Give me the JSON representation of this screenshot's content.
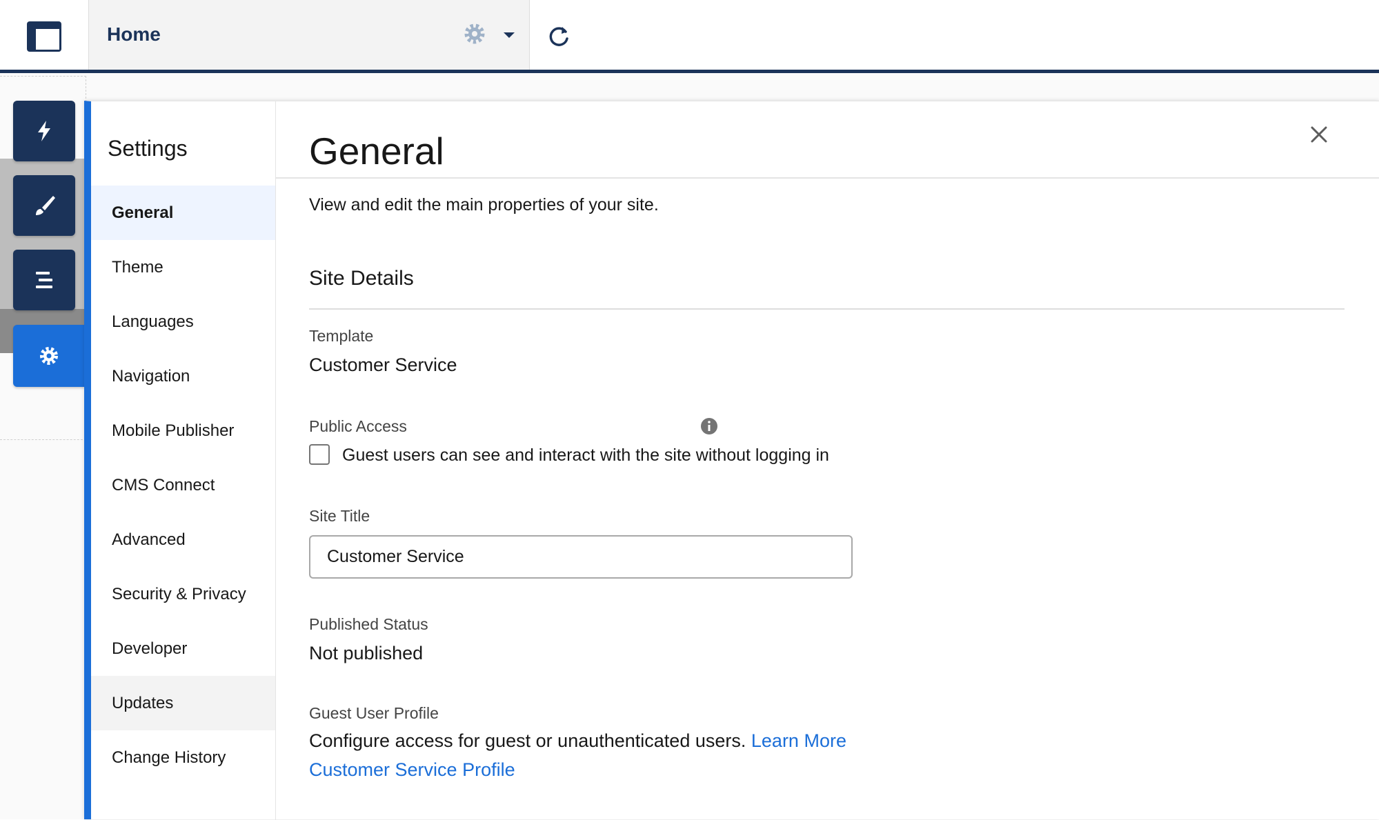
{
  "header": {
    "tab_title": "Home",
    "icons": [
      "app-layout-icon",
      "gear-icon",
      "chevron-down-icon",
      "refresh-icon"
    ]
  },
  "rail": {
    "buttons": [
      {
        "icon": "lightning-bolt-icon"
      },
      {
        "icon": "paintbrush-icon"
      },
      {
        "icon": "list-icon"
      },
      {
        "icon": "gear-icon",
        "active": true
      }
    ]
  },
  "settings": {
    "title": "Settings",
    "nav": [
      "General",
      "Theme",
      "Languages",
      "Navigation",
      "Mobile Publisher",
      "CMS Connect",
      "Advanced",
      "Security & Privacy",
      "Developer",
      "Updates",
      "Change History"
    ],
    "selected_index": 0,
    "hover_index": 9
  },
  "main": {
    "title": "General",
    "subtitle": "View and edit the main properties of your site.",
    "section_title": "Site Details",
    "template_label": "Template",
    "template_value": "Customer Service",
    "public_access_label": "Public Access",
    "public_access_checkbox_label": "Guest users can see and interact with the site without logging in",
    "public_access_checked": false,
    "site_title_label": "Site Title",
    "site_title_value": "Customer Service",
    "published_status_label": "Published Status",
    "published_status_value": "Not published",
    "guest_profile_label": "Guest User Profile",
    "guest_profile_desc": "Configure access for guest or unauthenticated users.",
    "learn_more": "Learn More",
    "guest_profile_link": "Customer Service Profile"
  },
  "colors": {
    "brand_navy": "#1b3359",
    "accent_blue": "#1b6ed8",
    "selected_bg": "#eef4ff"
  }
}
